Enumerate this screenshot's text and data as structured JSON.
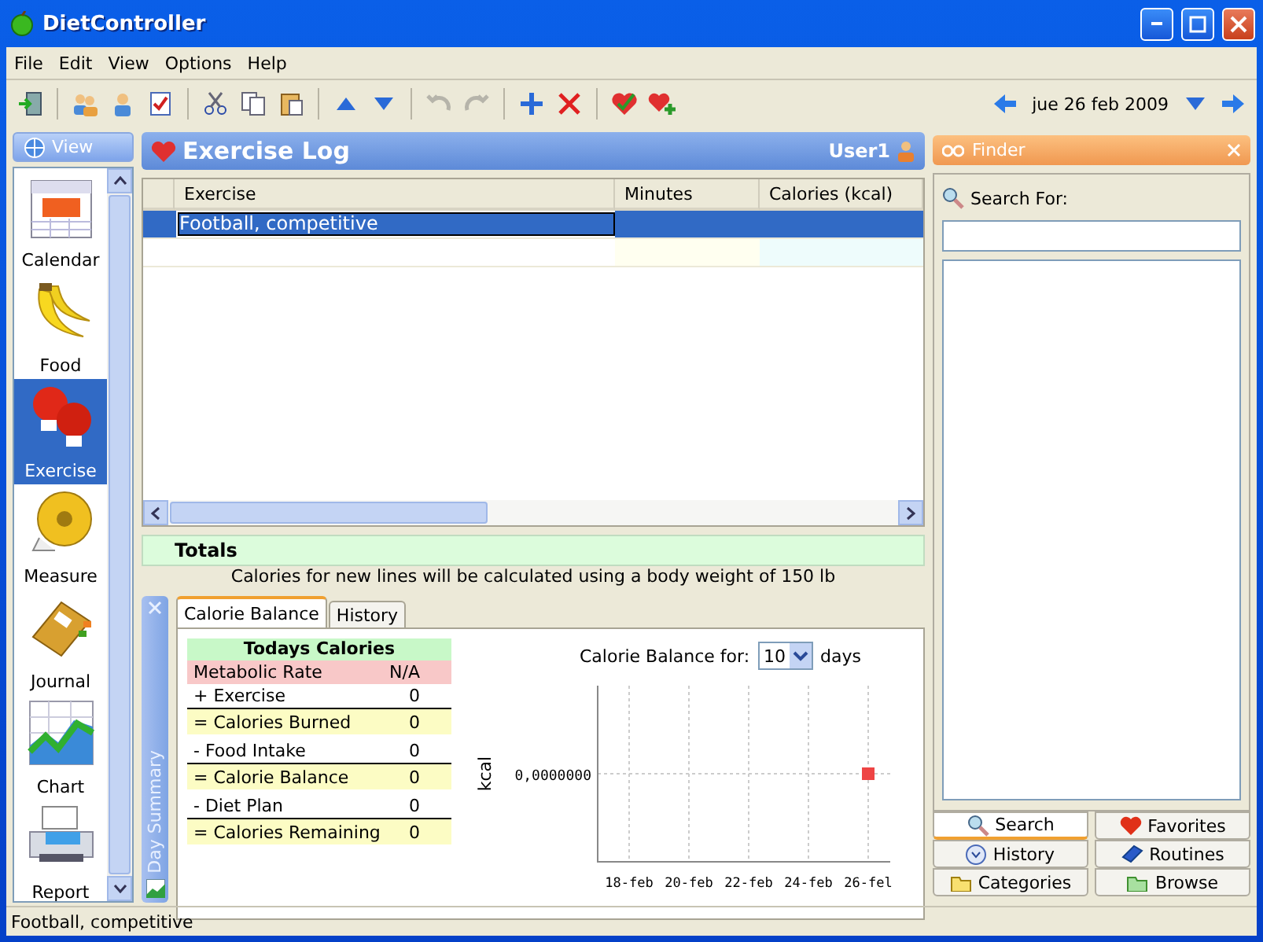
{
  "window": {
    "title": "DietController"
  },
  "menu": [
    "File",
    "Edit",
    "View",
    "Options",
    "Help"
  ],
  "toolbar": [
    {
      "kind": "exit",
      "disabled": false
    },
    {
      "kind": "sep"
    },
    {
      "kind": "users",
      "disabled": false
    },
    {
      "kind": "user",
      "disabled": false
    },
    {
      "kind": "checklist",
      "disabled": false
    },
    {
      "kind": "sep"
    },
    {
      "kind": "cut",
      "disabled": false
    },
    {
      "kind": "copy",
      "disabled": false
    },
    {
      "kind": "paste",
      "disabled": false
    },
    {
      "kind": "sep"
    },
    {
      "kind": "up",
      "disabled": false
    },
    {
      "kind": "down",
      "disabled": false
    },
    {
      "kind": "sep"
    },
    {
      "kind": "undo",
      "disabled": true
    },
    {
      "kind": "redo",
      "disabled": true
    },
    {
      "kind": "sep"
    },
    {
      "kind": "add",
      "disabled": false
    },
    {
      "kind": "delete",
      "disabled": false
    },
    {
      "kind": "sep"
    },
    {
      "kind": "heart-check",
      "disabled": false
    },
    {
      "kind": "heart-add",
      "disabled": false
    }
  ],
  "date": "jue 26 feb 2009",
  "nav": {
    "button": "View",
    "items": [
      {
        "kind": "calendar",
        "label": "Calendar",
        "selected": false
      },
      {
        "kind": "food",
        "label": "Food",
        "selected": false
      },
      {
        "kind": "exercise",
        "label": "Exercise",
        "selected": true
      },
      {
        "kind": "measure",
        "label": "Measure",
        "selected": false
      },
      {
        "kind": "journal",
        "label": "Journal",
        "selected": false
      },
      {
        "kind": "chart",
        "label": "Chart",
        "selected": false
      },
      {
        "kind": "report",
        "label": "Report",
        "selected": false
      }
    ]
  },
  "header": {
    "title": "Exercise Log",
    "user": "User1"
  },
  "table": {
    "columns": [
      "Exercise",
      "Minutes",
      "Calories (kcal)"
    ],
    "rows": [
      {
        "exercise": "Football, competitive",
        "selected": true
      }
    ],
    "totals": "Totals"
  },
  "note": "Calories for new lines will be calculated using a body weight of 150 lb",
  "day_summary": {
    "title": "Day Summary",
    "tabs": [
      {
        "label": "Calorie Balance",
        "selected": true
      },
      {
        "label": "History",
        "selected": false
      }
    ],
    "heading": "Todays Calories",
    "rows": [
      {
        "kind": "rate",
        "label": "Metabolic Rate",
        "value": "N/A"
      },
      {
        "kind": "plain",
        "label": "+ Exercise",
        "value": "0"
      },
      {
        "kind": "total",
        "label": "= Calories Burned",
        "value": "0"
      },
      {
        "kind": "plain",
        "label": "- Food Intake",
        "value": "0"
      },
      {
        "kind": "total",
        "label": "= Calorie Balance",
        "value": "0"
      },
      {
        "kind": "plain",
        "label": "- Diet Plan",
        "value": "0"
      },
      {
        "kind": "total",
        "label": "= Calories Remaining",
        "value": "0"
      }
    ],
    "balance_label": "Calorie Balance for:",
    "days_value": "10",
    "days_unit": "days",
    "plot": {
      "ylabel": "kcal",
      "value_label": "0,0000000",
      "x_labels": [
        "18-feb",
        "20-feb",
        "22-feb",
        "24-feb",
        "26-fel"
      ]
    }
  },
  "finder": {
    "title": "Finder",
    "search_label": "Search For:",
    "tabs": [
      {
        "kind": "search",
        "label": "Search",
        "selected": true
      },
      {
        "kind": "favorites",
        "label": "Favorites",
        "selected": false
      },
      {
        "kind": "history",
        "label": "History",
        "selected": false
      },
      {
        "kind": "routines",
        "label": "Routines",
        "selected": false
      },
      {
        "kind": "categories",
        "label": "Categories",
        "selected": false
      },
      {
        "kind": "browse",
        "label": "Browse",
        "selected": false
      }
    ]
  },
  "status_bar": "Football, competitive"
}
